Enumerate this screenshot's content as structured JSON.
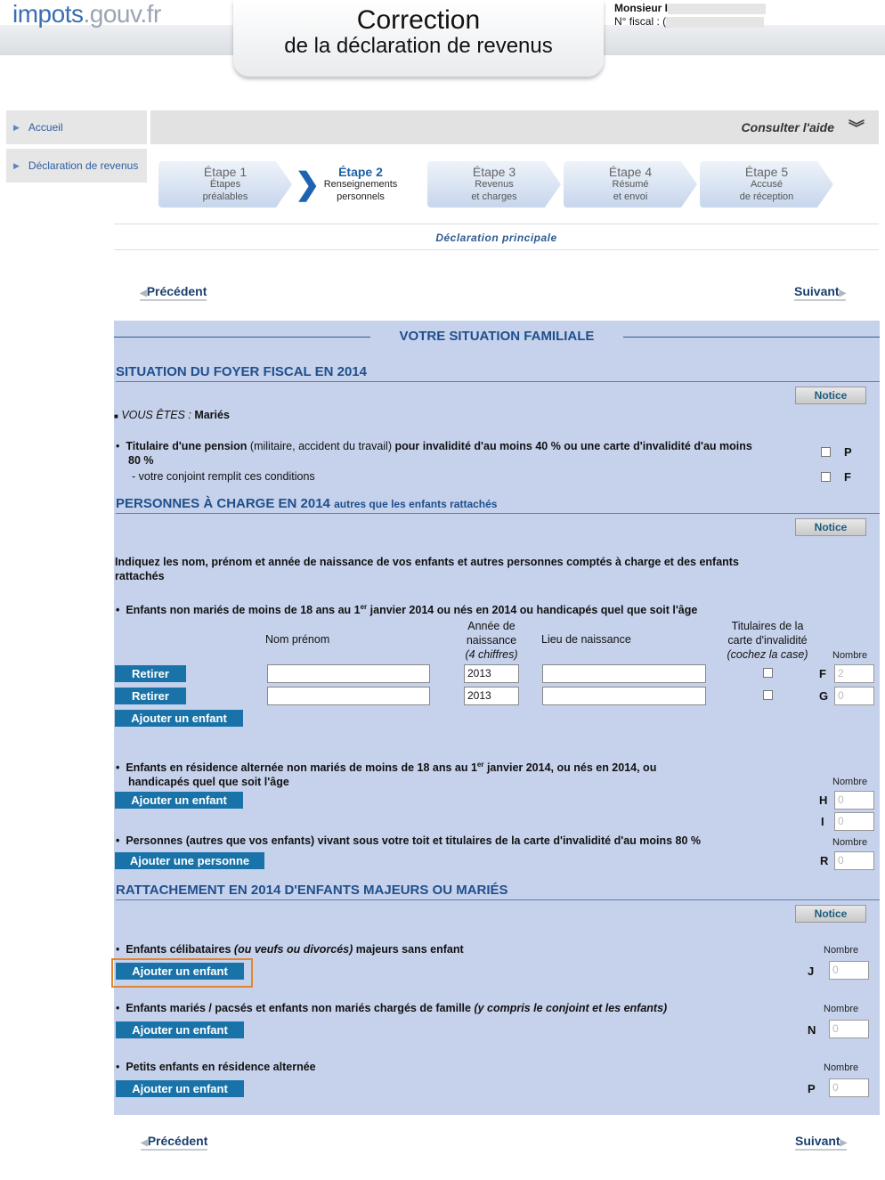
{
  "header": {
    "logo_main": "impots",
    "logo_rest": ".gouv.fr",
    "title_line1": "Correction",
    "title_line2": "de la déclaration de revenus",
    "user_name": "Monsieur I",
    "fiscal_label": "N° fiscal : ("
  },
  "sidebar": {
    "items": [
      {
        "label": "Accueil"
      },
      {
        "label": "Déclaration de revenus"
      }
    ]
  },
  "helpbar": {
    "label": "Consulter l'aide"
  },
  "steps": [
    {
      "num": "Étape 1",
      "line1": "Étapes",
      "line2": "préalables"
    },
    {
      "num": "Étape 2",
      "line1": "Renseignements",
      "line2": "personnels"
    },
    {
      "num": "Étape 3",
      "line1": "Revenus",
      "line2": "et charges"
    },
    {
      "num": "Étape 4",
      "line1": "Résumé",
      "line2": "et envoi"
    },
    {
      "num": "Étape 5",
      "line1": "Accusé",
      "line2": "de réception"
    }
  ],
  "declaration_label": "Déclaration principale",
  "nav": {
    "prev": "Précédent",
    "next": "Suivant"
  },
  "main": {
    "title": "VOTRE SITUATION FAMILIALE",
    "notice_label": "Notice",
    "sec1": {
      "title": "SITUATION DU FOYER FISCAL EN 2014",
      "vous_etes_label": "VOUS ÊTES :",
      "vous_etes_value": "Mariés",
      "pension_bold1": "Titulaire d'une pension",
      "pension_normal": "(militaire, accident du travail)",
      "pension_bold2": "pour invalidité d'au moins 40 % ou une carte d'invalidité d'au moins",
      "pension_line2": "80 %",
      "conjoint": "- votre conjoint remplit ces conditions",
      "box_p": "P",
      "box_f": "F"
    },
    "sec2": {
      "title": "PERSONNES À CHARGE EN 2014",
      "title_small": "autres que les enfants rattachés",
      "intro1": "Indiquez les nom, prénom et année de naissance de vos enfants et autres personnes comptés à charge et des enfants",
      "intro2": "rattachés",
      "enfants_label_a": "Enfants non mariés de moins de 18 ans au 1",
      "enfants_sup": "er",
      "enfants_label_b": " janvier 2014 ou nés en 2014 ou handicapés quel que soit l'âge",
      "col_nom": "Nom prénom",
      "col_annee1": "Année de",
      "col_annee2": "naissance",
      "col_annee3": "(4 chiffres)",
      "col_lieu": "Lieu de naissance",
      "col_tit1": "Titulaires de la",
      "col_tit2": "carte d'invalidité",
      "col_tit3": "(cochez la case)",
      "col_nombre": "Nombre",
      "retirer": "Retirer",
      "rows": [
        {
          "nom": "",
          "annee": "2013",
          "lieu": "",
          "code": "F",
          "nombre": "2"
        },
        {
          "nom": "",
          "annee": "2013",
          "lieu": "",
          "code": "G",
          "nombre": "0"
        }
      ],
      "ajouter_enfant": "Ajouter un enfant",
      "alt_label1a": "Enfants en résidence alternée non mariés de moins de 18 ans au 1",
      "alt_sup": "er",
      "alt_label1b": " janvier 2014, ou nés en 2014, ou",
      "alt_label2": "handicapés quel que soit l'âge",
      "alt_codes": [
        {
          "code": "H",
          "nombre": "0"
        },
        {
          "code": "I",
          "nombre": "0"
        }
      ],
      "pers_label": "Personnes (autres que vos enfants) vivant sous votre toit et titulaires de la carte d'invalidité d'au moins 80 %",
      "ajouter_personne": "Ajouter une personne",
      "pers_code": "R",
      "pers_nombre": "0"
    },
    "sec3": {
      "title": "RATTACHEMENT EN 2014 D'ENFANTS MAJEURS OU MARIÉS",
      "celib_bold": "Enfants célibataires",
      "celib_italic": "(ou veufs ou divorcés)",
      "celib_bold2": "majeurs sans enfant",
      "celib_code": "J",
      "celib_nombre": "0",
      "maries_bold": "Enfants mariés / pacsés et enfants non mariés chargés de famille",
      "maries_italic": "(y compris le conjoint et les enfants)",
      "maries_code": "N",
      "maries_nombre": "0",
      "petits_bold": "Petits enfants en résidence alternée",
      "petits_code": "P",
      "petits_nombre": "0"
    }
  }
}
